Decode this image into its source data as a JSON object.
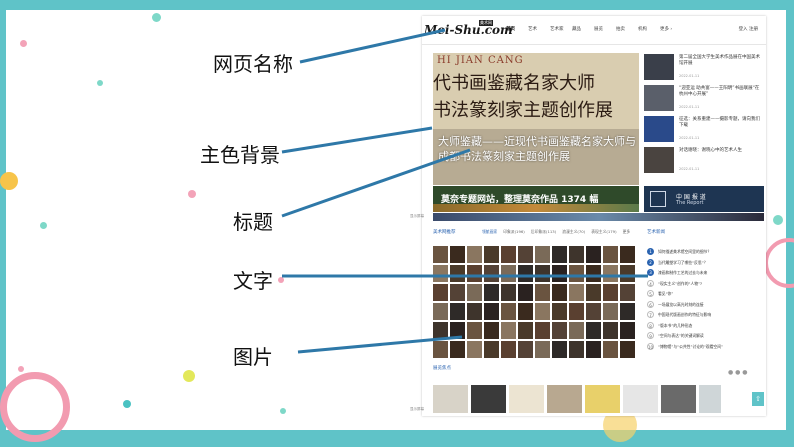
{
  "annotations": [
    "网页名称",
    "主色背景",
    "标题",
    "文字",
    "图片"
  ],
  "site": {
    "logo": "Mei-Shu.com",
    "logo_sub": "美术网",
    "nav": [
      "首页",
      "艺术",
      "艺术家",
      "藏品",
      "展览",
      "拍卖",
      "机构",
      "更多 ›"
    ],
    "top_right": "登入    注册",
    "hero": {
      "en": "HI JIAN CANG",
      "line1": "代书画鉴藏名家大师",
      "line2": "书法篆刻家主题创作展",
      "caption": "大师鉴藏——近现代书画鉴藏名家大师与成都书法篆刻家主题创作展"
    },
    "news": [
      {
        "title": "第二届全国大学生美术作品展在中国美术馆开展",
        "date": "2022-01-11"
      },
      {
        "title": "“迎亚运 助共富——王阳明”书画联展“在杭州中心开展”",
        "date": "2022-01-11"
      },
      {
        "title": "征选：关系重建——摄影专题，请向我们下载",
        "date": "2022-01-11"
      },
      {
        "title": "对话谢晓：谢晓心中的艺术人生",
        "date": "2022-01-11"
      }
    ],
    "banner1": "莫奈专题网站，整理莫奈作品 1374 幅",
    "banner2_title": "中 国 报 道",
    "banner2_sub": "The Report",
    "section1": "美术网推荐",
    "tabs": [
      "领航画家",
      "印象派(196)",
      "后印象派(113)",
      "浪漫主义(70)",
      "表现主义(179)",
      "更多"
    ],
    "section_right": "艺术新闻",
    "rank": [
      "如何描述美术馆空间里的细节？",
      "当代雕塑学习了哪些“反思”？",
      "漆画和制作工艺的过去与未来",
      "“现实主义”创作的“人物”?",
      "看见“你”",
      "一场展览以高光时刻的连接",
      "中国现代版画创作的特征与影响",
      "“版本书”的几种形态",
      "“空间与表达”的关键词解读",
      "“博物馆”与“公共性”讨论的“观看空间”"
    ],
    "section2": "展览焦点",
    "side_label_1": "显示屏幕",
    "side_label_2": "显示屏幕",
    "side_btn": "⇧",
    "more_dots": "● ● ●",
    "colors": {
      "accent": "#2a63b0",
      "frame": "#5fc3c8",
      "pointer": "#2e78a8"
    }
  }
}
